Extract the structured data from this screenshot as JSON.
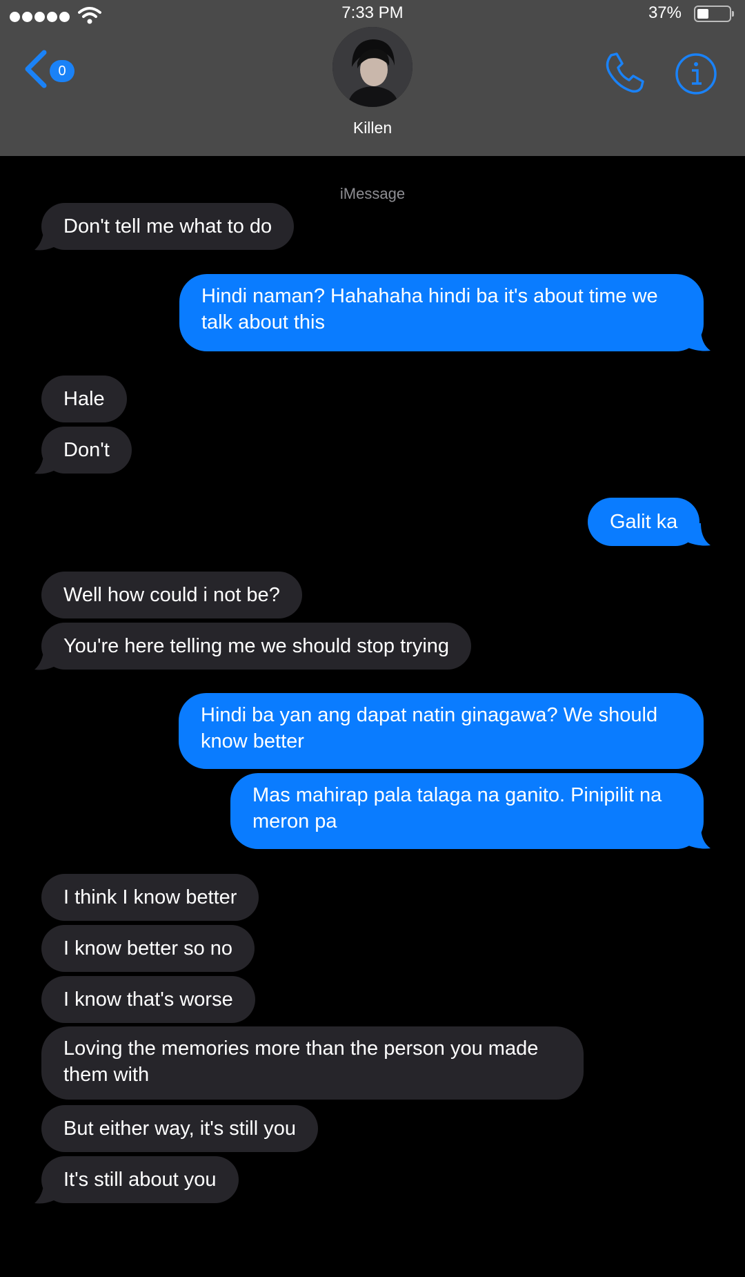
{
  "status_bar": {
    "time": "7:33 PM",
    "battery": "37%",
    "battery_level": 0.37,
    "icons": [
      "signal-dots-icon",
      "wifi-icon",
      "battery-icon"
    ]
  },
  "header": {
    "back_badge": "0",
    "contact_name": "Killen",
    "icons": [
      "back-chevron-icon",
      "phone-icon",
      "info-icon"
    ]
  },
  "thread": {
    "service_label": "iMessage",
    "messages": [
      {
        "from": "them",
        "text": "Don't tell me what to do"
      },
      {
        "from": "me",
        "text": "Hindi naman? Hahahaha hindi ba it's about time we talk about this"
      },
      {
        "from": "them",
        "text": "Hale"
      },
      {
        "from": "them",
        "text": "Don't"
      },
      {
        "from": "me",
        "text": "Galit ka"
      },
      {
        "from": "them",
        "text": "Well how could i not be?"
      },
      {
        "from": "them",
        "text": "You're here telling me we should stop trying"
      },
      {
        "from": "me",
        "text": "Hindi ba yan ang dapat natin ginagawa? We should know better"
      },
      {
        "from": "me",
        "text": "Mas mahirap pala talaga na ganito. Pinipilit na meron pa"
      },
      {
        "from": "them",
        "text": "I think I know better"
      },
      {
        "from": "them",
        "text": "I know better so no"
      },
      {
        "from": "them",
        "text": "I know that's worse"
      },
      {
        "from": "them",
        "text": "Loving the memories more than the person you made them with"
      },
      {
        "from": "them",
        "text": "But either way, it's still you"
      },
      {
        "from": "them",
        "text": "It's still about you"
      }
    ]
  },
  "colors": {
    "header_bg": "#4a4a4a",
    "background": "#000000",
    "incoming_bubble": "#26252a",
    "outgoing_bubble": "#0a7cff",
    "accent": "#1a82f7"
  }
}
